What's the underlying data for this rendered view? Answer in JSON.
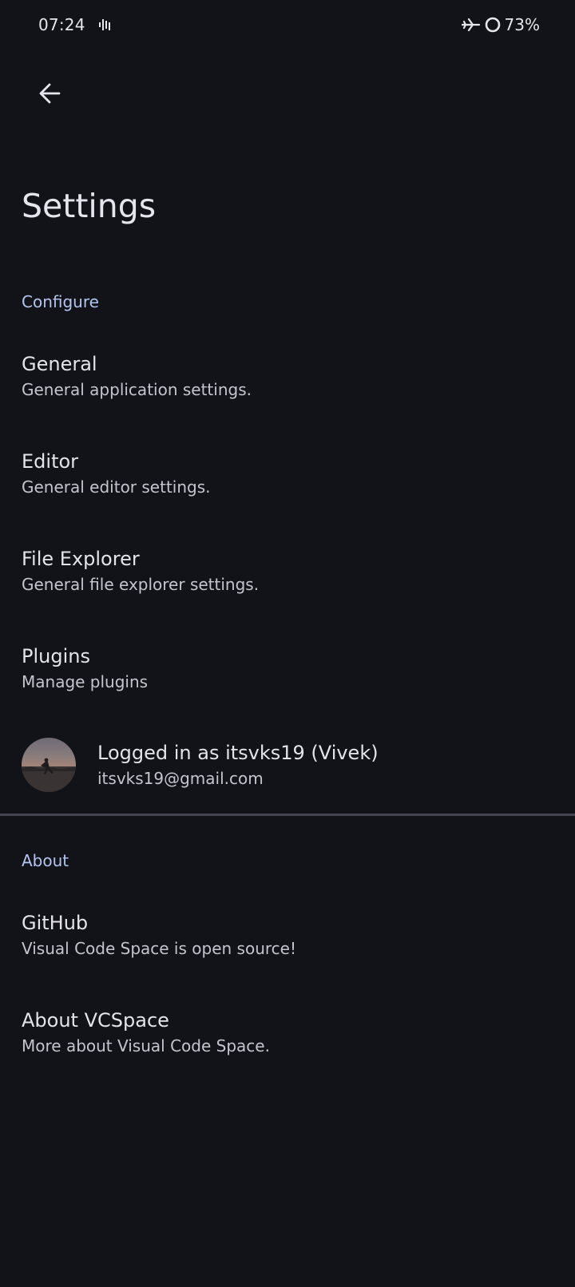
{
  "status_bar": {
    "time": "07:24",
    "battery": "73%",
    "icons": [
      "signal-bars-icon",
      "airplane-mode-icon",
      "battery-ring-icon"
    ]
  },
  "toolbar": {
    "back_icon": "arrow-back-icon"
  },
  "page": {
    "title": "Settings"
  },
  "configure": {
    "header": "Configure",
    "items": [
      {
        "title": "General",
        "summary": "General application settings."
      },
      {
        "title": "Editor",
        "summary": "General editor settings."
      },
      {
        "title": "File Explorer",
        "summary": "General file explorer settings."
      },
      {
        "title": "Plugins",
        "summary": "Manage plugins"
      }
    ]
  },
  "account": {
    "title": "Logged in as itsvks19 (Vivek)",
    "email": "itsvks19@gmail.com"
  },
  "about": {
    "header": "About",
    "items": [
      {
        "title": "GitHub",
        "summary": "Visual Code Space is open source!"
      },
      {
        "title": "About VCSpace",
        "summary": "More about Visual Code Space."
      }
    ]
  },
  "colors": {
    "background": "#121318",
    "accent": "#b3c4ee",
    "divider": "#44464f"
  }
}
